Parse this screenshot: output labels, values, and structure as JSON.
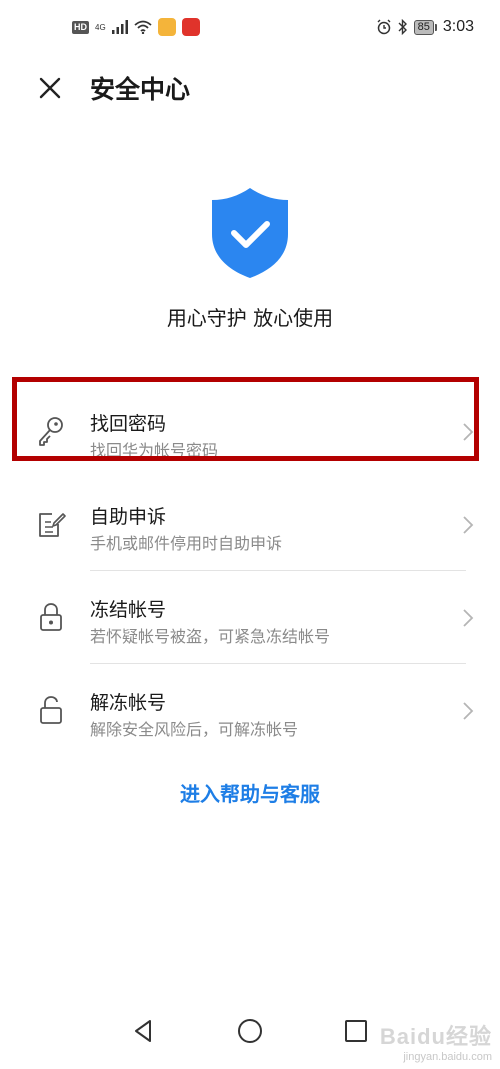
{
  "status_bar": {
    "hd": "HD",
    "network": "4G",
    "battery": "85",
    "time": "3:03"
  },
  "header": {
    "title": "安全中心",
    "close_icon": "close-icon"
  },
  "hero": {
    "icon": "shield-check-icon",
    "slogan": "用心守护 放心使用",
    "accent": "#2b86f0"
  },
  "menu": [
    {
      "icon": "key-icon",
      "title": "找回密码",
      "subtitle": "找回华为帐号密码",
      "highlighted": true
    },
    {
      "icon": "edit-document-icon",
      "title": "自助申诉",
      "subtitle": "手机或邮件停用时自助申诉"
    },
    {
      "icon": "lock-icon",
      "title": "冻结帐号",
      "subtitle": "若怀疑帐号被盗，可紧急冻结帐号"
    },
    {
      "icon": "unlock-icon",
      "title": "解冻帐号",
      "subtitle": "解除安全风险后，可解冻帐号"
    }
  ],
  "help_link": "进入帮助与客服",
  "colors": {
    "link": "#1e7ee6",
    "highlight_border": "#b30000"
  },
  "watermark": {
    "brand": "Baidu经验",
    "url": "jingyan.baidu.com"
  }
}
